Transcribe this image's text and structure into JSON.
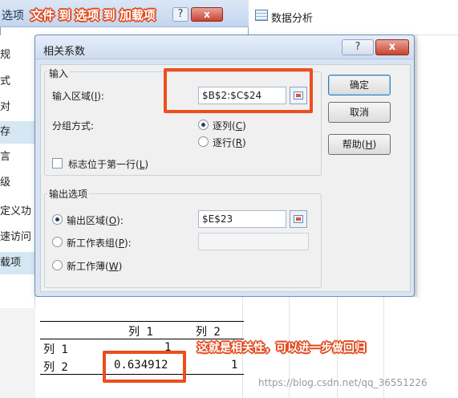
{
  "annotations": {
    "top": "文件 到 选项 到 加载项",
    "bottom": "这就是相关性，可以进一步做回归"
  },
  "back_window": {
    "title": "选项",
    "sidebar": [
      "规",
      "式",
      "对",
      "存",
      "言",
      "级",
      "定义功",
      "速访问",
      "载项"
    ]
  },
  "ribbon": {
    "data_analysis": "数据分析"
  },
  "dialog": {
    "title": "相关系数",
    "help_glyph": "?",
    "close_glyph": "x",
    "input_group": "输入",
    "input_range_label": "输入区域(",
    "input_range_key": "I",
    "input_range_tail": "):",
    "input_range_value": "$B$2:$C$24",
    "grouping_label": "分组方式:",
    "by_column_label": "逐列(",
    "by_column_key": "C",
    "by_row_label": "逐行(",
    "by_row_key": "R",
    "labels_first_row": "标志位于第一行(",
    "labels_first_row_key": "L",
    "output_group": "输出选项",
    "output_range_label": "输出区域(",
    "output_range_key": "O",
    "output_range_value": "$E$23",
    "new_sheet_label": "新工作表组(",
    "new_sheet_key": "P",
    "new_book_label": "新工作薄(",
    "new_book_key": "W",
    "ok": "确定",
    "cancel": "取消",
    "help_label": "帮助(",
    "help_key": "H"
  },
  "result_table": {
    "headers": [
      "列 1",
      "列 2"
    ],
    "rows": [
      {
        "label": "列 1",
        "c1": "1",
        "c2": ""
      },
      {
        "label": "列 2",
        "c1": "0.634912",
        "c2": "1"
      }
    ]
  },
  "watermark": "https://blog.csdn.net/qq_36551226"
}
